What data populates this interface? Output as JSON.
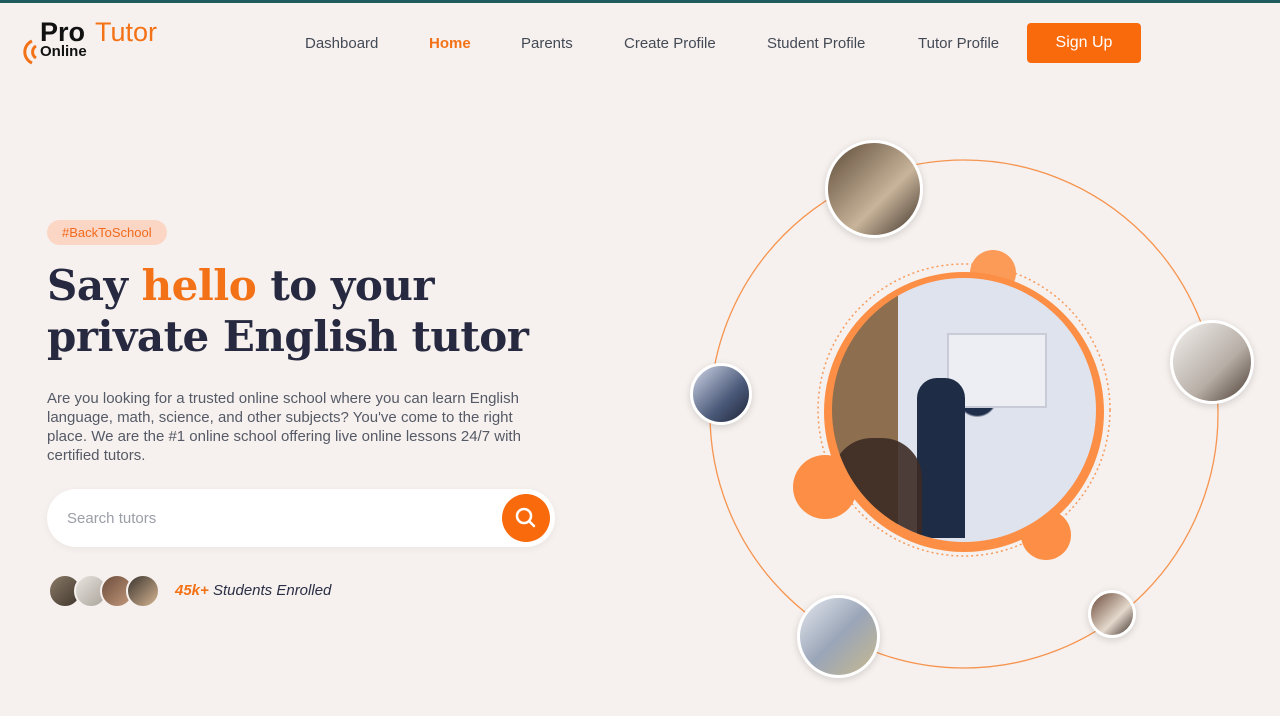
{
  "brand": {
    "part1": "Pro",
    "part2": "Tutor",
    "part3": "Online"
  },
  "nav": {
    "items": [
      {
        "label": "Dashboard"
      },
      {
        "label": "Home"
      },
      {
        "label": "Parents"
      },
      {
        "label": "Create Profile"
      },
      {
        "label": "Student Profile"
      },
      {
        "label": "Tutor Profile"
      }
    ],
    "active": "Home",
    "signup_label": "Sign Up"
  },
  "hero": {
    "tag": "#BackToSchool",
    "headline_part1": "Say ",
    "headline_highlight": "hello",
    "headline_part2": " to your private English tutor",
    "description": "Are you looking for a trusted online school where you can learn English language, math, science, and other subjects? You've come to the right place. We are the #1 online school offering live online lessons 24/7 with certified tutors.",
    "search_placeholder": "Search tutors",
    "enrolled_count": "45k+",
    "enrolled_label": " Students Enrolled"
  },
  "colors": {
    "accent": "#f47217",
    "button": "#f96a0c",
    "background": "#f6f1ee",
    "heading": "#26293f"
  },
  "icons": {
    "search": "search-icon"
  }
}
